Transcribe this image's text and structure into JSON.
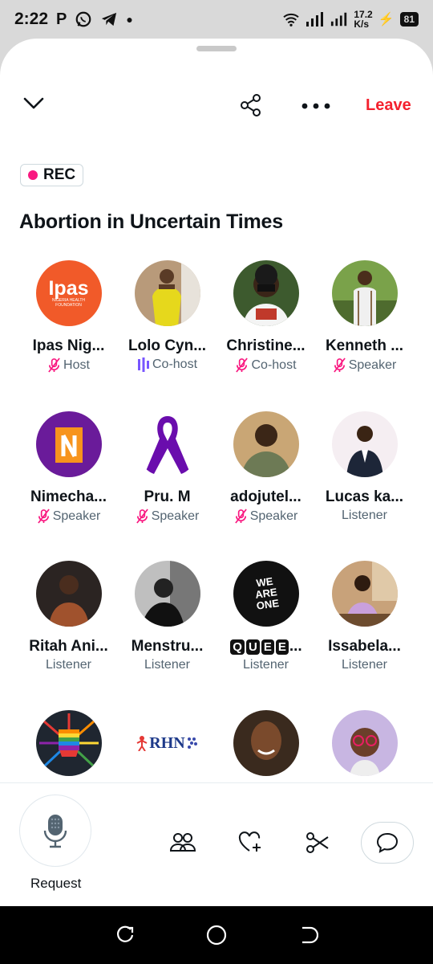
{
  "status": {
    "time": "2:22",
    "carrier_icon": "P",
    "speed_top": "17.2",
    "speed_bottom": "K/s",
    "battery": "81"
  },
  "header": {
    "leave_label": "Leave",
    "rec_label": "REC"
  },
  "space": {
    "title": "Abortion in Uncertain Times"
  },
  "participants": [
    {
      "name": "Ipas Nig...",
      "role": "Host",
      "mic": "muted",
      "avatar": "ipas-logo"
    },
    {
      "name": "Lolo Cyn...",
      "role": "Co-host",
      "mic": "speaking",
      "avatar": "photo-yellow"
    },
    {
      "name": "Christine...",
      "role": "Co-host",
      "mic": "muted",
      "avatar": "photo-masked"
    },
    {
      "name": "Kenneth ...",
      "role": "Speaker",
      "mic": "muted",
      "avatar": "photo-outdoor"
    },
    {
      "name": "Nimecha...",
      "role": "Speaker",
      "mic": "muted",
      "avatar": "n-logo"
    },
    {
      "name": "Pru. M",
      "role": "Speaker",
      "mic": "muted",
      "avatar": "purple-ribbon"
    },
    {
      "name": "adojutel...",
      "role": "Speaker",
      "mic": "muted",
      "avatar": "photo-man"
    },
    {
      "name": "Lucas ka...",
      "role": "Listener",
      "mic": "none",
      "avatar": "photo-suit"
    },
    {
      "name": "Ritah Ani...",
      "role": "Listener",
      "mic": "none",
      "avatar": "photo-woman"
    },
    {
      "name": "Menstru...",
      "role": "Listener",
      "mic": "none",
      "avatar": "photo-bw"
    },
    {
      "name": "QUEE...",
      "role": "Listener",
      "mic": "none",
      "avatar": "we-are-one"
    },
    {
      "name": "Issabela...",
      "role": "Listener",
      "mic": "none",
      "avatar": "photo-desk"
    },
    {
      "name": "",
      "role": "",
      "mic": "none",
      "avatar": "rainbow-fist"
    },
    {
      "name": "",
      "role": "",
      "mic": "none",
      "avatar": "rhn-logo"
    },
    {
      "name": "",
      "role": "",
      "mic": "none",
      "avatar": "photo-smile"
    },
    {
      "name": "",
      "role": "",
      "mic": "none",
      "avatar": "photo-glasses"
    }
  ],
  "ipas_logo": {
    "text": "Ipas",
    "sub": "NIGERIA HEALTH FOUNDATION"
  },
  "we_are_one": {
    "text": "WE ARE ONE"
  },
  "rhn_logo": {
    "text": "RHN"
  },
  "bottom": {
    "request_label": "Request"
  },
  "colors": {
    "accent_red": "#f4212e",
    "rec_dot": "#f91880",
    "speaking": "#7856ff",
    "muted": "#f91880"
  }
}
